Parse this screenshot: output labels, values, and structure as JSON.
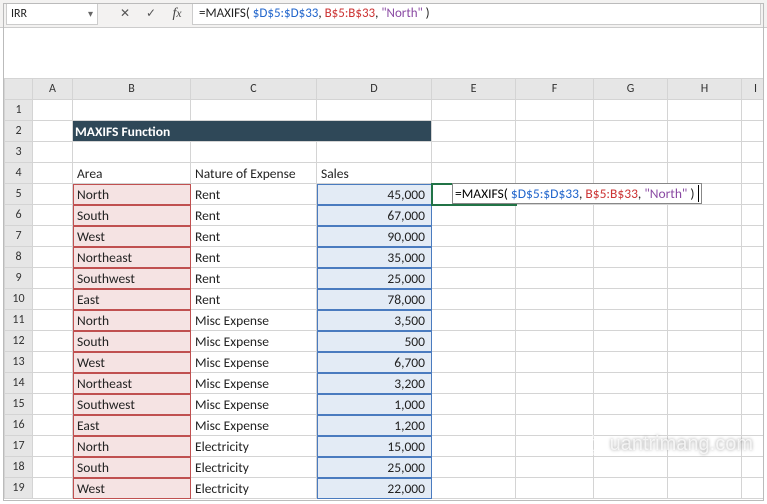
{
  "nameBox": "IRR",
  "formulaBar": "=MAXIFS( $D$5:$D$33, B$5:B$33, \"North\" )",
  "formulaParts": {
    "prefix": "=MAXIFS( ",
    "range1": "$D$5:$D$33",
    "sep1": ", ",
    "range2": "B$5:B$33",
    "sep2": ", ",
    "str": "\"North\"",
    "suffix": " )"
  },
  "columns": [
    "",
    "A",
    "B",
    "C",
    "D",
    "E",
    "F",
    "G",
    "H",
    "I"
  ],
  "title": "MAXIFS Function",
  "headers": {
    "area": "Area",
    "nature": "Nature of Expense",
    "sales": "Sales"
  },
  "rows": [
    {
      "n": 5,
      "area": "North",
      "nature": "Rent",
      "sales": "45,000"
    },
    {
      "n": 6,
      "area": "South",
      "nature": "Rent",
      "sales": "67,000"
    },
    {
      "n": 7,
      "area": "West",
      "nature": "Rent",
      "sales": "90,000"
    },
    {
      "n": 8,
      "area": "Northeast",
      "nature": "Rent",
      "sales": "35,000"
    },
    {
      "n": 9,
      "area": "Southwest",
      "nature": "Rent",
      "sales": "25,000"
    },
    {
      "n": 10,
      "area": "East",
      "nature": "Rent",
      "sales": "78,000"
    },
    {
      "n": 11,
      "area": "North",
      "nature": "Misc Expense",
      "sales": "3,500"
    },
    {
      "n": 12,
      "area": "South",
      "nature": "Misc Expense",
      "sales": "500"
    },
    {
      "n": 13,
      "area": "West",
      "nature": "Misc Expense",
      "sales": "6,700"
    },
    {
      "n": 14,
      "area": "Northeast",
      "nature": "Misc Expense",
      "sales": "3,200"
    },
    {
      "n": 15,
      "area": "Southwest",
      "nature": "Misc Expense",
      "sales": "1,000"
    },
    {
      "n": 16,
      "area": "East",
      "nature": "Misc Expense",
      "sales": "1,200"
    },
    {
      "n": 17,
      "area": "North",
      "nature": "Electricity",
      "sales": "15,000"
    },
    {
      "n": 18,
      "area": "South",
      "nature": "Electricity",
      "sales": "25,000"
    },
    {
      "n": 19,
      "area": "West",
      "nature": "Electricity",
      "sales": "22,000"
    }
  ],
  "watermark": "uantrimang.com",
  "activeCellFormula": "=MAXIFS( $D$5:$D$33, B$5:B$33, \"North\" )"
}
